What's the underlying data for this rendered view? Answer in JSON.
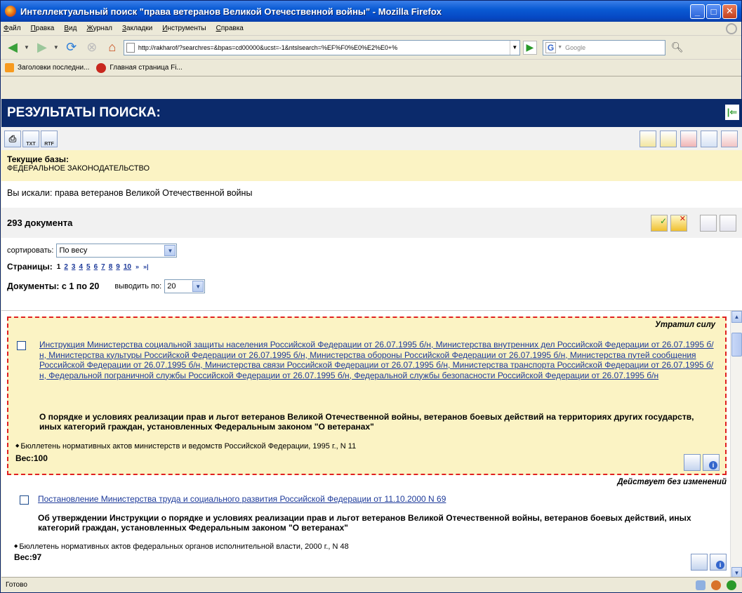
{
  "window": {
    "title": "Интеллектуальный поиск \"права ветеранов Великой Отечественной войны\" - Mozilla Firefox"
  },
  "menu": [
    "Файл",
    "Правка",
    "Вид",
    "Журнал",
    "Закладки",
    "Инструменты",
    "Справка"
  ],
  "nav": {
    "url": "http://rakharof/?searchres=&bpas=cd00000&ucst=-1&ntslsearch=%EF%F0%E0%E2%E0+%",
    "search_placeholder": "Google"
  },
  "bookmarks": [
    {
      "label": "Заголовки последни...",
      "icon": "rss-icon"
    },
    {
      "label": "Главная страница Fi...",
      "icon": "firefox-icon"
    }
  ],
  "page": {
    "heading": "РЕЗУЛЬТАТЫ ПОИСКА:",
    "tool_txt": "TXT",
    "tool_rtf": "RTF",
    "bases_label": "Текущие базы:",
    "bases_value": "ФЕДЕРАЛЬНОЕ ЗАКОНОДАТЕЛЬСТВО",
    "searched": "Вы искали: права ветеранов Великой Отечественной войны",
    "count": "293 документа",
    "sort_label": "сортировать:",
    "sort_value": "По весу",
    "pages_label": "Страницы:",
    "current_page": "1",
    "pages": [
      "2",
      "3",
      "4",
      "5",
      "6",
      "7",
      "8",
      "9",
      "10"
    ],
    "next_arrows": "»",
    "last_arrows": "»|",
    "docs_label": "Документы: с 1 по 20",
    "output_label": "выводить по:",
    "output_value": "20"
  },
  "results": [
    {
      "status": "Утратил силу",
      "title": "Инструкция Министерства социальной защиты населения Российской Федерации от 26.07.1995 б/н, Министерства внутренних дел Российской Федерации от 26.07.1995 б/н, Министерства культуры Российской Федерации от 26.07.1995 б/н, Министерства обороны Российской Федерации от 26.07.1995 б/н, Министерства путей сообщения Российской Федерации от 26.07.1995 б/н, Министерства связи Российской Федерации от 26.07.1995 б/н, Министерства транспорта Российской Федерации от 26.07.1995 б/н, Федеральной пограничной службы Российской Федерации от 26.07.1995 б/н, Федеральной службы безопасности Российской Федерации от 26.07.1995 б/н",
      "description": "О порядке и условиях реализации прав и льгот ветеранов Великой Отечественной войны, ветеранов боевых действий на территориях других государств, иных категорий граждан, установленных Федеральным законом \"О ветеранах\"",
      "source": "Бюллетень нормативных актов министерств и ведомств Российской Федерации, 1995 г., N 11",
      "weight": "Вес:100"
    },
    {
      "status": "Действует без изменений",
      "title": "Постановление Министерства труда и социального развития Российской Федерации от 11.10.2000 N 69",
      "description": "Об утверждении Инструкции о порядке и условиях реализации прав и льгот ветеранов Великой Отечественной войны, ветеранов боевых действий, иных категорий граждан, установленных Федеральным законом \"О ветеранах\"",
      "source": "Бюллетень нормативных актов федеральных органов исполнительной власти, 2000 г., N 48",
      "weight": "Вес:97"
    }
  ],
  "statusbar": {
    "text": "Готово"
  }
}
